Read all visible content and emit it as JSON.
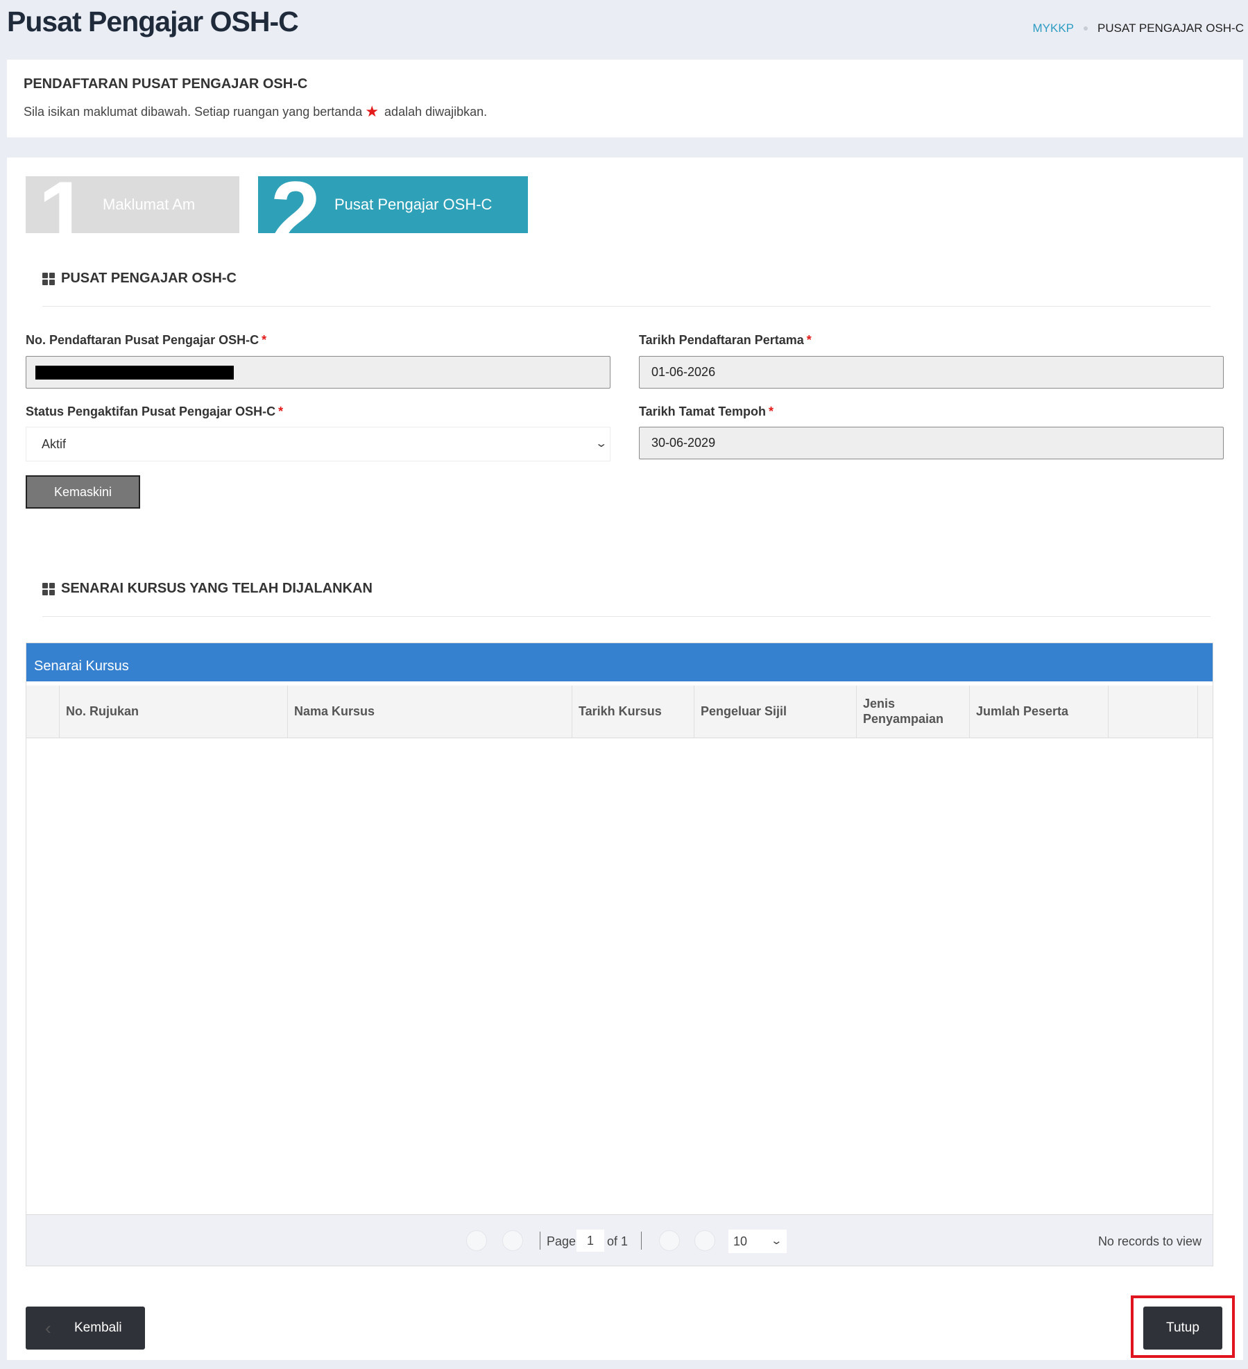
{
  "header": {
    "title": "Pusat Pengajar OSH-C",
    "breadcrumb": [
      "MYKKP",
      "PUSAT PENGAJAR OSH-C"
    ]
  },
  "intro": {
    "heading": "PENDAFTARAN PUSAT PENGAJAR OSH-C",
    "text_before": "Sila isikan maklumat dibawah. Setiap ruangan yang bertanda",
    "text_after": "adalah diwajibkan."
  },
  "steps": [
    {
      "number": "1",
      "label": "Maklumat Am"
    },
    {
      "number": "2",
      "label": "Pusat Pengajar OSH-C"
    }
  ],
  "section1": {
    "title": "PUSAT PENGAJAR OSH-C",
    "fields": {
      "reg_no_label": "No. Pendaftaran Pusat Pengajar OSH-C",
      "reg_no_value": "",
      "first_reg_label": "Tarikh Pendaftaran Pertama",
      "first_reg_value": "01-06-2026",
      "status_label": "Status Pengaktifan Pusat Pengajar OSH-C",
      "status_value": "Aktif",
      "expiry_label": "Tarikh Tamat Tempoh",
      "expiry_value": "30-06-2029"
    },
    "required_mark": "*",
    "update_button": "Kemaskini"
  },
  "section2": {
    "title": "SENARAI KURSUS YANG TELAH DIJALANKAN",
    "grid": {
      "caption": "Senarai Kursus",
      "columns": [
        "No. Rujukan",
        "Nama Kursus",
        "Tarikh Kursus",
        "Pengeluar Sijil",
        "Jenis Penyampaian",
        "Jumlah Peserta"
      ],
      "rows": [],
      "pager": {
        "page_label": "Page",
        "page": "1",
        "of_label": "of 1",
        "page_size": "10",
        "records_text": "No records to view"
      }
    }
  },
  "footer": {
    "back_button": "Kembali",
    "close_button": "Tutup"
  },
  "colors": {
    "step_active": "#2ea0b7",
    "step_inactive": "#dcdcdc",
    "grid_caption": "#3580cf",
    "required": "#e31b1b",
    "highlight_border": "#e0141e"
  }
}
